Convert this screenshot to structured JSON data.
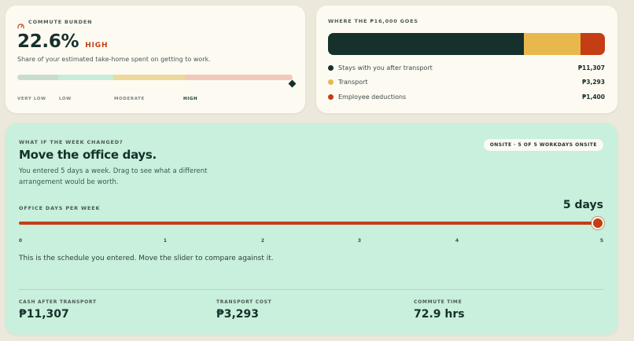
{
  "burden": {
    "eyebrow": "COMMUTE BURDEN",
    "icon": "gauge-icon",
    "percent": "22.6%",
    "level": "HIGH",
    "description": "Share of your estimated take-home spent on getting to work.",
    "scale_labels": [
      "VERY LOW",
      "LOW",
      "MODERATE",
      "HIGH"
    ],
    "active_level": "HIGH",
    "marker_fraction": 0.226,
    "scale_colors": [
      "#c9ddcf",
      "#c7ecd9",
      "#eed99a",
      "#f1c9ba"
    ]
  },
  "breakdown": {
    "eyebrow": "WHERE THE ₱16,000 GOES",
    "items": [
      {
        "label": "Stays with you after transport",
        "value": "₱11,307",
        "amount": 11307,
        "color": "#16302b"
      },
      {
        "label": "Transport",
        "value": "₱3,293",
        "amount": 3293,
        "color": "#e8b84c"
      },
      {
        "label": "Employee deductions",
        "value": "₱1,400",
        "amount": 1400,
        "color": "#c43d15"
      }
    ]
  },
  "scenario": {
    "eyebrow": "WHAT IF THE WEEK CHANGED?",
    "title": "Move the office days.",
    "description": "You entered 5 days a week. Drag to see what a different arrangement would be worth.",
    "badge": "ONSITE · 5 OF 5 WORKDAYS ONSITE",
    "slider_label": "OFFICE DAYS PER WEEK",
    "slider_value_text": "5 days",
    "slider_value": 5,
    "slider_ticks": [
      "0",
      "1",
      "2",
      "3",
      "4",
      "5"
    ],
    "note": "This is the schedule you entered. Move the slider to compare against it.",
    "stats": [
      {
        "label": "CASH AFTER TRANSPORT",
        "value": "₱11,307"
      },
      {
        "label": "TRANSPORT COST",
        "value": "₱3,293"
      },
      {
        "label": "COMMUTE TIME",
        "value": "72.9 hrs"
      }
    ]
  }
}
